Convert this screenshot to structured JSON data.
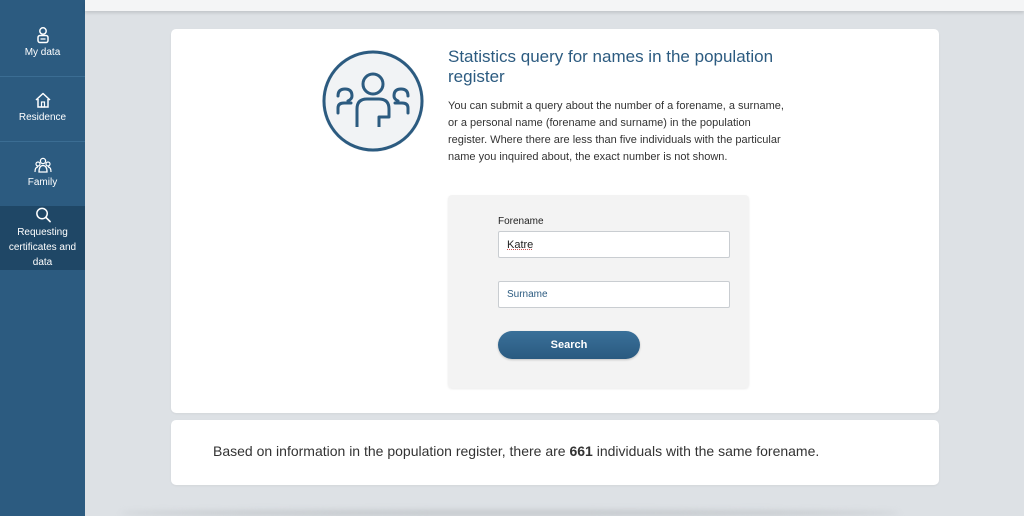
{
  "sidebar": {
    "items": [
      {
        "label": "My data",
        "icon": "user-badge-icon"
      },
      {
        "label": "Residence",
        "icon": "house-icon"
      },
      {
        "label": "Family",
        "icon": "family-icon"
      },
      {
        "label": "Requesting certificates and data",
        "icon": "search-icon"
      }
    ]
  },
  "main": {
    "emblem_icon": "people-group-icon",
    "title": "Statistics query for names in the population register",
    "description": "You can submit a query about the number of a forename, a surname, or a personal name (forename and surname) in the population register. Where there are less than five individuals with the particular name you inquired about, the exact number is not shown.",
    "form": {
      "forename_label": "Forename",
      "forename_value": "Katre",
      "surname_placeholder": "Surname",
      "search_label": "Search"
    }
  },
  "result": {
    "prefix": "Based on information in the population register, there are",
    "count": "661",
    "suffix": "individuals with the same forename."
  },
  "colors": {
    "sidebar": "#2c5b80",
    "sidebar_active": "#1f4766",
    "accent": "#2c5b80",
    "background": "#dde1e5"
  }
}
